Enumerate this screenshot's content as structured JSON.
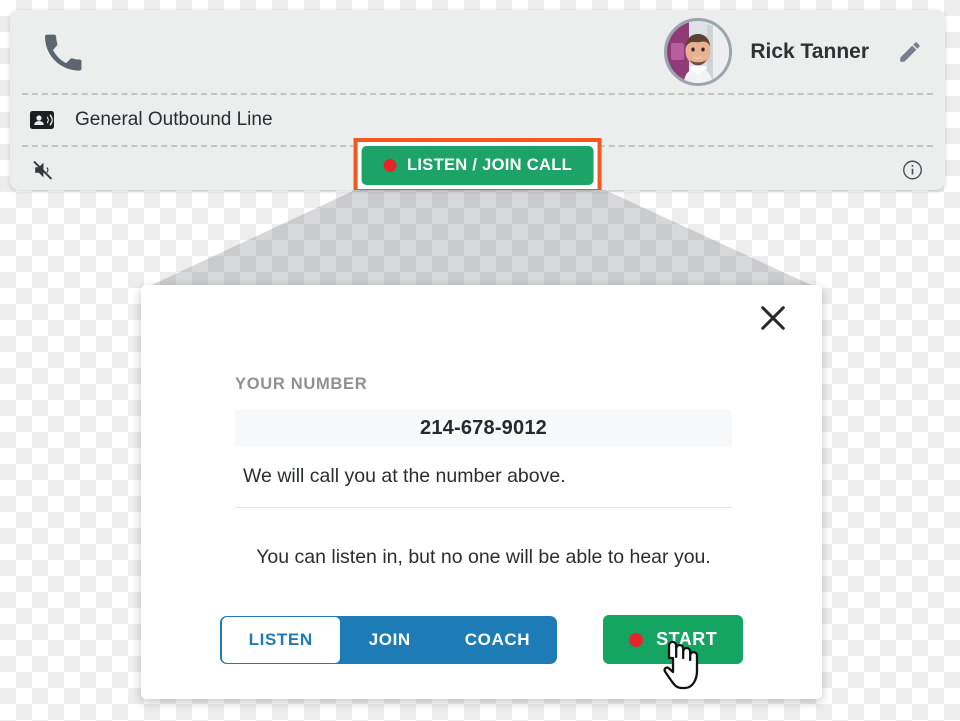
{
  "call_card": {
    "phone_icon": "phone-icon",
    "agent_name": "Rick Tanner",
    "avatar_alt": "agent-avatar-photo",
    "edit_icon": "pencil-edit-icon",
    "line_icon": "contact-card-icon",
    "line_label": "General Outbound Line",
    "mute_icon": "speaker-muted-icon",
    "listen_join_label": "LISTEN / JOIN CALL",
    "info_icon": "info-circle-icon",
    "highlight_color": "#f4581e",
    "green": "#1ba368",
    "record_dot_color": "#e8242b"
  },
  "dialog": {
    "close_icon": "close-x-icon",
    "your_number_label": "YOUR NUMBER",
    "phone_number": "214-678-9012",
    "callback_note": "We will call you at the number above.",
    "mode_note": "You can listen in, but no one will be able to hear you.",
    "modes": [
      {
        "label": "LISTEN",
        "selected": true
      },
      {
        "label": "JOIN",
        "selected": false
      },
      {
        "label": "COACH",
        "selected": false
      }
    ],
    "start_label": "START",
    "accent_blue": "#1d7cb5",
    "accent_green": "#14a563",
    "record_dot_color": "#e8242b"
  }
}
